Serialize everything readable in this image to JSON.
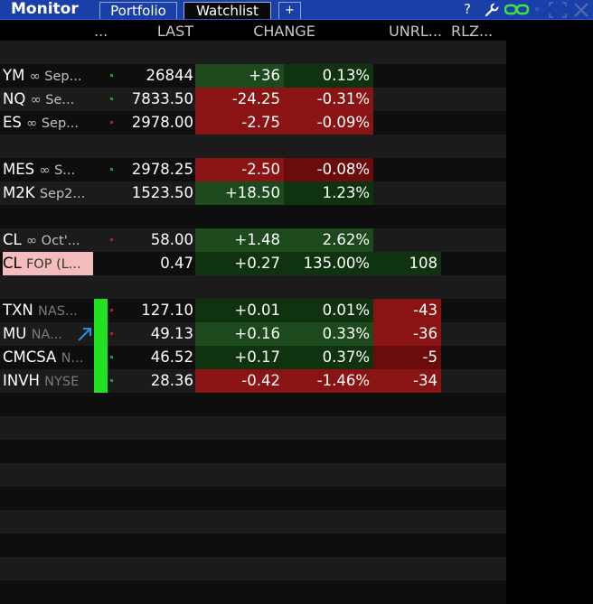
{
  "window": {
    "title": "Monitor",
    "tabs": [
      {
        "label": "Portfolio",
        "active": false
      },
      {
        "label": "Watchlist",
        "active": true
      },
      {
        "label": "+",
        "active": false
      }
    ],
    "icons": [
      "help-icon",
      "wrench-icon",
      "link-icon",
      "float-icon",
      "close-icon"
    ],
    "help_label": "?"
  },
  "columns": {
    "symbol": "...",
    "last": "LAST",
    "change": "CHANGE",
    "unrl": "UNRL...",
    "rlz": "RLZ..."
  },
  "rows": [
    {
      "type": "empty"
    },
    {
      "type": "data",
      "sym": "YM",
      "sub": "∞ Sep...",
      "dot": "g",
      "last": "26844",
      "chg": "+36",
      "pct": "0.13%",
      "chg_bg": "g1",
      "pct_bg": "g2",
      "unrl": ""
    },
    {
      "type": "data",
      "sym": "NQ",
      "sub": "∞ Se...",
      "dot": "g",
      "last": "7833.50",
      "chg": "-24.25",
      "pct": "-0.31%",
      "chg_bg": "r1",
      "pct_bg": "r1",
      "unrl": ""
    },
    {
      "type": "data",
      "sym": "ES",
      "sub": "∞ Sep...",
      "dot": "r",
      "last": "2978.00",
      "chg": "-2.75",
      "pct": "-0.09%",
      "chg_bg": "r1",
      "pct_bg": "r1",
      "unrl": ""
    },
    {
      "type": "empty"
    },
    {
      "type": "data",
      "sym": "MES",
      "sub": "∞ S...",
      "dot": "g",
      "last": "2978.25",
      "chg": "-2.50",
      "pct": "-0.08%",
      "chg_bg": "r1",
      "pct_bg": "r2",
      "unrl": ""
    },
    {
      "type": "data",
      "sym": "M2K",
      "sub": "Sep2...",
      "dot": "",
      "last": "1523.50",
      "chg": "+18.50",
      "pct": "1.23%",
      "chg_bg": "g1",
      "pct_bg": "g2",
      "unrl": ""
    },
    {
      "type": "empty"
    },
    {
      "type": "data",
      "sym": "CL",
      "sub": "∞ Oct'...",
      "dot": "r",
      "last": "58.00",
      "chg": "+1.48",
      "pct": "2.62%",
      "chg_bg": "g1",
      "pct_bg": "g1",
      "unrl": ""
    },
    {
      "type": "data",
      "sym": "CL",
      "sub": "FOP (L...",
      "dot": "",
      "pink": true,
      "last": "0.47",
      "chg": "+0.27",
      "pct": "135.00%",
      "chg_bg": "g2",
      "pct_bg": "g2",
      "unrl": "108",
      "unrl_bg": "g2"
    },
    {
      "type": "empty"
    },
    {
      "type": "data",
      "sym": "TXN",
      "sub": "NAS...",
      "grey": true,
      "dot": "r",
      "last": "127.10",
      "chg": "+0.01",
      "pct": "0.01%",
      "chg_bg": "g2",
      "pct_bg": "g2",
      "unrl": "-43",
      "unrl_bg": "r1"
    },
    {
      "type": "data",
      "sym": "MU",
      "sub": "NA...",
      "grey": true,
      "dot": "r",
      "arrow": true,
      "last": "49.13",
      "chg": "+0.16",
      "pct": "0.33%",
      "chg_bg": "g1",
      "pct_bg": "g1",
      "unrl": "-36",
      "unrl_bg": "r1"
    },
    {
      "type": "data",
      "sym": "CMCSA",
      "sub": "N...",
      "grey": true,
      "dot": "g",
      "last": "46.52",
      "chg": "+0.17",
      "pct": "0.37%",
      "chg_bg": "g2",
      "pct_bg": "g2",
      "unrl": "-5",
      "unrl_bg": "r2"
    },
    {
      "type": "data",
      "sym": "INVH",
      "sub": "NYSE",
      "grey": true,
      "dot": "g",
      "last": "28.36",
      "chg": "-0.42",
      "pct": "-1.46%",
      "chg_bg": "r1",
      "pct_bg": "r1",
      "unrl": "-34",
      "unrl_bg": "r1"
    }
  ],
  "empty_rows_after": 9
}
